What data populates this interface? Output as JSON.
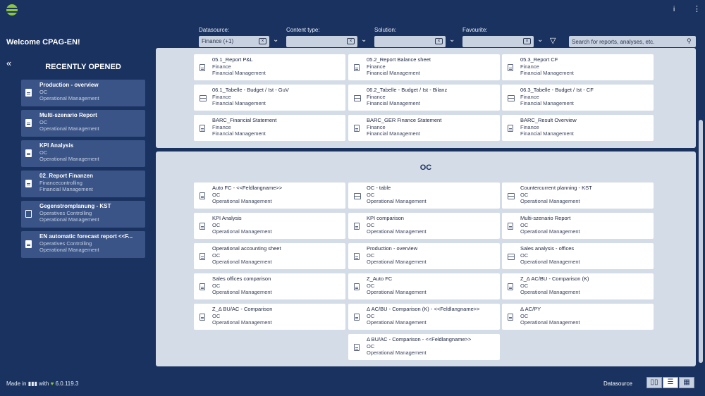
{
  "topbar": {
    "info": "i",
    "menu": "⋮"
  },
  "welcome": "Welcome CPAG-EN!",
  "filters": [
    {
      "label": "Datasource:",
      "value": "Finance (+1)"
    },
    {
      "label": "Content type:",
      "value": ""
    },
    {
      "label": "Solution:",
      "value": ""
    },
    {
      "label": "Favourite:",
      "value": ""
    }
  ],
  "search": {
    "placeholder": "Search for reports, analyses, etc."
  },
  "sidebar": {
    "title": "RECENTLY OPENED",
    "items": [
      {
        "title": "Production - overview",
        "sub1": "OC",
        "sub2": "Operational Management",
        "icon": "document-icon"
      },
      {
        "title": "Multi-szenario Report",
        "sub1": "OC",
        "sub2": "Operational Management",
        "icon": "document-icon"
      },
      {
        "title": "KPI Analysis",
        "sub1": "OC",
        "sub2": "Operational Management",
        "icon": "document-icon"
      },
      {
        "title": "02_Report Finanzen",
        "sub1": "Financecontrolling",
        "sub2": "Financial Management",
        "icon": "document-icon"
      },
      {
        "title": "Gegenstromplanung - KST",
        "sub1": "Operatives Controlling",
        "sub2": "Operational Management",
        "icon": "table-icon"
      },
      {
        "title": "EN automatic forecast report <<F...",
        "sub1": "Operatives Controlling",
        "sub2": "Operational Management",
        "icon": "document-icon"
      }
    ]
  },
  "finance_cards": [
    {
      "title": "05.1_Report P&L",
      "sub1": "Finance",
      "sub2": "Financial Management",
      "icon": "document-icon"
    },
    {
      "title": "05.2_Report Balance sheet",
      "sub1": "Finance",
      "sub2": "Financial Management",
      "icon": "document-icon"
    },
    {
      "title": "05.3_Report CF",
      "sub1": "Finance",
      "sub2": "Financial Management",
      "icon": "document-icon"
    },
    {
      "title": "06.1_Tabelle - Budget / Ist - GuV",
      "sub1": "Finance",
      "sub2": "Financial Management",
      "icon": "table-icon"
    },
    {
      "title": "06.2_Tabelle - Budget / Ist - Bilanz",
      "sub1": "Finance",
      "sub2": "Financial Management",
      "icon": "table-icon"
    },
    {
      "title": "06.3_Tabelle - Budget / Ist - CF",
      "sub1": "Finance",
      "sub2": "Financial Management",
      "icon": "table-icon"
    },
    {
      "title": "BARC_Financial Statement",
      "sub1": "Finance",
      "sub2": "Financial Management",
      "icon": "document-icon"
    },
    {
      "title": "BARC_GER Finance Statement",
      "sub1": "Finance",
      "sub2": "Financial Management",
      "icon": "document-icon"
    },
    {
      "title": "BARC_Result Overview",
      "sub1": "Finance",
      "sub2": "Financial Management",
      "icon": "document-icon"
    }
  ],
  "oc_section": {
    "title": "OC"
  },
  "oc_cards": [
    {
      "title": "Auto FC - <<Feldlangname>>",
      "sub1": "OC",
      "sub2": "Operational Management",
      "icon": "document-icon"
    },
    {
      "title": "OC - table",
      "sub1": "OC",
      "sub2": "Operational Management",
      "icon": "table-icon"
    },
    {
      "title": "Countercurrent planning - KST",
      "sub1": "OC",
      "sub2": "Operational Management",
      "icon": "table-icon"
    },
    {
      "title": "KPI Analysis",
      "sub1": "OC",
      "sub2": "Operational Management",
      "icon": "document-icon"
    },
    {
      "title": "KPI comparison",
      "sub1": "OC",
      "sub2": "Operational Management",
      "icon": "document-icon"
    },
    {
      "title": "Multi-szenario Report",
      "sub1": "OC",
      "sub2": "Operational Management",
      "icon": "document-icon"
    },
    {
      "title": "Operational accounting sheet",
      "sub1": "OC",
      "sub2": "Operational Management",
      "icon": "document-icon"
    },
    {
      "title": "Production - overview",
      "sub1": "OC",
      "sub2": "Operational Management",
      "icon": "document-icon"
    },
    {
      "title": "Sales analysis - offices",
      "sub1": "OC",
      "sub2": "Operational Management",
      "icon": "table-icon"
    },
    {
      "title": "Sales offices comparison",
      "sub1": "OC",
      "sub2": "Operational Management",
      "icon": "document-icon"
    },
    {
      "title": "Z_Auto FC",
      "sub1": "OC",
      "sub2": "Operational Management",
      "icon": "document-icon"
    },
    {
      "title": "Z_Δ AC/BU - Comparison (K)",
      "sub1": "OC",
      "sub2": "Operational Management",
      "icon": "document-icon"
    },
    {
      "title": "Z_Δ BU/AC - Comparison",
      "sub1": "OC",
      "sub2": "Operational Management",
      "icon": "document-icon"
    },
    {
      "title": "Δ AC/BU - Comparison (K) - <<Feldlangname>>",
      "sub1": "OC",
      "sub2": "Operational Management",
      "icon": "document-icon"
    },
    {
      "title": "Δ AC/PY",
      "sub1": "OC",
      "sub2": "Operational Management",
      "icon": "document-icon"
    },
    {
      "title": "Δ BU/AC - Comparison - <<Feldlangname>>",
      "sub1": "OC",
      "sub2": "Operational Management",
      "icon": "document-icon"
    }
  ],
  "footer": {
    "made_in": "Made in",
    "made_with": "with",
    "version": "6.0.119.3",
    "datasource": "Datasource"
  },
  "colors": {
    "background": "#1a3260",
    "panel": "#d4dce7",
    "card": "#ffffff",
    "accent": "#8dc63f"
  }
}
